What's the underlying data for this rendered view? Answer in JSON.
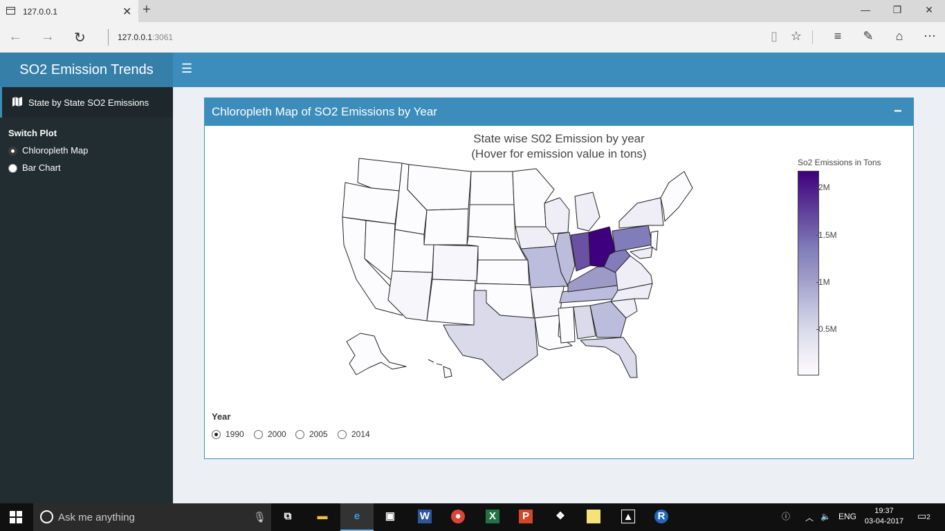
{
  "browser": {
    "tab_title": "127.0.0.1",
    "url_host": "127.0.0.1",
    "url_port": ":3061"
  },
  "app": {
    "brand": "SO2 Emission Trends",
    "menu_item": "State by State SO2 Emissions",
    "switch_plot_label": "Switch Plot",
    "plot_options": [
      {
        "label": "Chloropleth Map",
        "selected": true
      },
      {
        "label": "Bar Chart",
        "selected": false
      }
    ]
  },
  "box": {
    "title": "Chloropleth Map of SO2 Emissions by Year",
    "collapse_label": "−"
  },
  "chart_data": {
    "type": "choropleth",
    "title": "State wise S02 Emission by year",
    "subtitle": "(Hover for emission value in tons)",
    "colorbar_title": "So2 Emissions in Tons",
    "colorbar_ticks": [
      "2M",
      "1.5M",
      "1M",
      "0.5M"
    ],
    "colorbar_tick_values": [
      2000000,
      1500000,
      1000000,
      500000
    ],
    "colorscale": [
      "#fcfbfd",
      "#3f007d"
    ],
    "year": 1990
  },
  "year_selector": {
    "label": "Year",
    "options": [
      {
        "label": "1990",
        "selected": true
      },
      {
        "label": "2000",
        "selected": false
      },
      {
        "label": "2005",
        "selected": false
      },
      {
        "label": "2014",
        "selected": false
      }
    ]
  },
  "taskbar": {
    "search_placeholder": "Ask me anything",
    "language": "ENG",
    "time": "19:37",
    "date": "03-04-2017",
    "notification_count": "2"
  }
}
